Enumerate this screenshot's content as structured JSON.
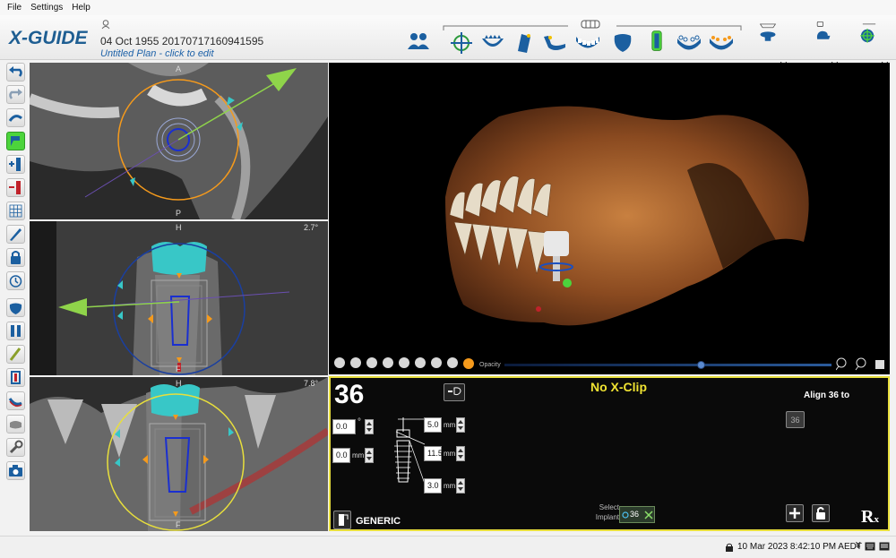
{
  "menu": {
    "file": "File",
    "settings": "Settings",
    "help": "Help"
  },
  "header": {
    "logo": "X-GUIDE",
    "patient": "04 Oct 1955 20170717160941595",
    "plan": "Untitled Plan - click to edit"
  },
  "toolbar": {
    "icons": [
      "users-icon",
      "crosshair-tooth-icon",
      "arch-icon",
      "panoramic-icon",
      "jaw-curve-icon",
      "teeth-row-icon",
      "tooth-icon",
      "implant-icon",
      "lower-arch-icon",
      "lower-arch-orange-icon",
      "scan-device-icon",
      "settings-face-icon",
      "target-icon"
    ]
  },
  "views": {
    "axial": {
      "label_top": "A",
      "label_bottom": "P"
    },
    "coronal": {
      "label_top": "H",
      "label_bottom": "F",
      "angle": "2.7°"
    },
    "sagittal": {
      "label_top": "H",
      "label_bottom": "F",
      "angle": "7.8°"
    }
  },
  "view3d": {
    "opacity_label": "Opacity",
    "opacity_value": 0.6,
    "head_icons": [
      "head-front-icon",
      "head-left-icon",
      "head-right-icon",
      "head-back-icon",
      "head-top-icon",
      "head-bottom-icon",
      "sphere-icon",
      "sphere-icon",
      "tooth-crown-icon",
      "teeth-orange-icon"
    ]
  },
  "implant_panel": {
    "tooth_number": "36",
    "xclip_status": "No X-Clip",
    "align_label": "Align 36 to",
    "align_button": "36",
    "angle_value": "0.0",
    "angle_unit": "°",
    "offset_value": "0.0",
    "offset_unit": "mm",
    "diameter_value": "5.0",
    "diameter_unit": "mm",
    "length_value": "11.5",
    "length_unit": "mm",
    "depth_value": "3.0",
    "depth_unit": "mm",
    "select_label_1": "Select",
    "select_label_2": "Implant",
    "selected_implant": "36",
    "brand": "GENERIC",
    "rx_label": "R",
    "rx_sub": "x"
  },
  "status": {
    "datetime": "10 Mar 2023 8:42:10 PM AEDT",
    "symbol": "¥"
  },
  "colors": {
    "accent": "#1e5e92",
    "active_green": "#4cd43c",
    "clip_yellow": "#f0e332",
    "panel_border": "#e8df3c",
    "crown_cyan": "#38c7c7",
    "arrow_green": "#8fd44a",
    "orange": "#f59a1c"
  }
}
